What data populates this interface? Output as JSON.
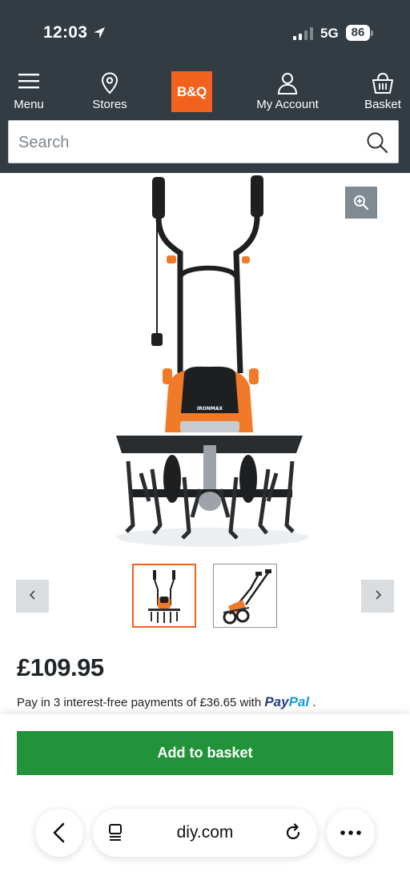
{
  "status_bar": {
    "time": "12:03",
    "network": "5G",
    "battery": "86"
  },
  "nav": {
    "menu_label": "Menu",
    "stores_label": "Stores",
    "logo_text": "B&Q",
    "account_label": "My Account",
    "basket_label": "Basket"
  },
  "search": {
    "placeholder": "Search"
  },
  "product": {
    "brand_on_image": "IRONMAX",
    "price": "£109.95",
    "paypal": {
      "text": "Pay in 3 interest-free payments of £36.65 with",
      "logo_pay": "Pay",
      "logo_pal": "Pal",
      "suffix": "."
    }
  },
  "actions": {
    "add_to_basket": "Add to basket"
  },
  "browser": {
    "url": "diy.com"
  },
  "colors": {
    "header_bg": "#323c42",
    "brand_orange": "#f0621e",
    "cta_green": "#22923b"
  }
}
